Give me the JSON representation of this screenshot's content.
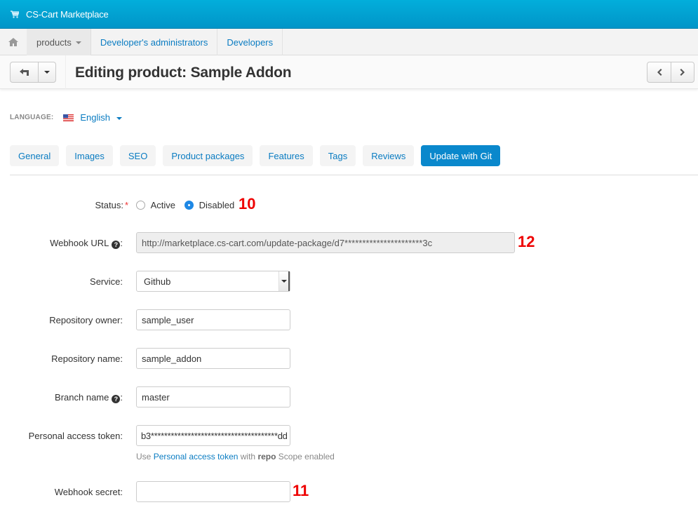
{
  "topbar": {
    "brand": "CS-Cart Marketplace",
    "icon": "cart-icon"
  },
  "nav": {
    "home_icon": "home-icon",
    "items": [
      {
        "label": "products",
        "active": true,
        "has_dropdown": true
      },
      {
        "label": "Developer's administrators",
        "active": false
      },
      {
        "label": "Developers",
        "active": false
      }
    ]
  },
  "titlebar": {
    "title": "Editing product: Sample Addon",
    "back_icon": "back-arrow-icon",
    "prev_icon": "chevron-left-icon",
    "next_icon": "chevron-right-icon"
  },
  "language": {
    "label": "LANGUAGE:",
    "value": "English",
    "flag": "us-flag-icon"
  },
  "tabs": [
    {
      "label": "General",
      "active": false
    },
    {
      "label": "Images",
      "active": false
    },
    {
      "label": "SEO",
      "active": false
    },
    {
      "label": "Product packages",
      "active": false
    },
    {
      "label": "Features",
      "active": false
    },
    {
      "label": "Tags",
      "active": false
    },
    {
      "label": "Reviews",
      "active": false
    },
    {
      "label": "Update with Git",
      "active": true
    }
  ],
  "form": {
    "status": {
      "label": "Status:",
      "required_mark": "*",
      "options": [
        "Active",
        "Disabled"
      ],
      "selected": "Disabled",
      "annotation": "10"
    },
    "webhook_url": {
      "label": "Webhook URL",
      "value": "http://marketplace.cs-cart.com/update-package/d7**********************3c",
      "annotation": "12"
    },
    "service": {
      "label": "Service:",
      "value": "Github"
    },
    "repo_owner": {
      "label": "Repository owner:",
      "value": "sample_user"
    },
    "repo_name": {
      "label": "Repository name:",
      "value": "sample_addon"
    },
    "branch": {
      "label": "Branch name",
      "value": "master"
    },
    "token": {
      "label": "Personal access token:",
      "value": "b3**************************************dd",
      "hint_prefix": "Use ",
      "hint_link": "Personal access token",
      "hint_mid": " with ",
      "hint_bold": "repo",
      "hint_suffix": " Scope enabled"
    },
    "webhook_secret": {
      "label": "Webhook secret:",
      "value": "",
      "annotation": "11"
    }
  },
  "colors": {
    "accent": "#0a88cc",
    "link": "#0a7cc2",
    "topbar": "#01a3d4",
    "annotation": "#e00000"
  }
}
